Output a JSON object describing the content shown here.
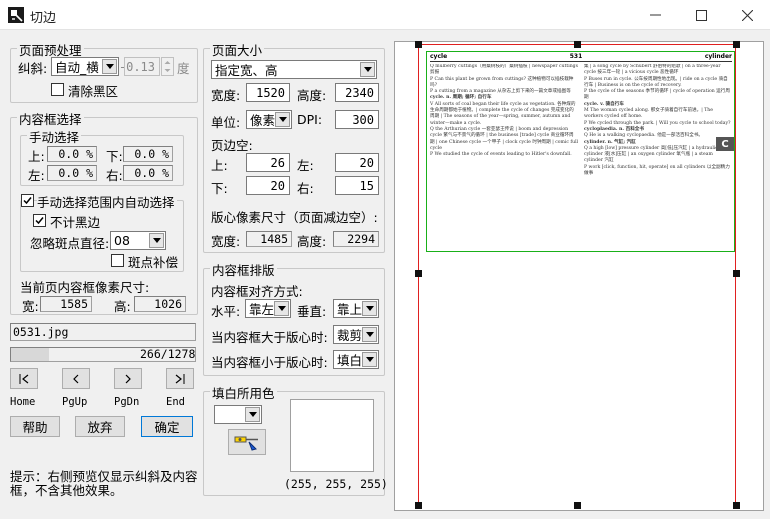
{
  "window": {
    "title": "切边"
  },
  "preprocess": {
    "title": "页面预处理",
    "deskew_label": "纠斜:",
    "deskew_mode": "自动_横",
    "deskew_value": "-0.13",
    "deskew_unit": "度",
    "clear_black_label": "清除黑区"
  },
  "content_select": {
    "title": "内容框选择",
    "manual": {
      "title": "手动选择",
      "top_label": "上:",
      "top_value": "0.0 %",
      "bottom_label": "下:",
      "bottom_value": "0.0 %",
      "left_label": "左:",
      "left_value": "0.0 %",
      "right_label": "右:",
      "right_value": "0.0 %"
    },
    "auto_in_range_label": "手动选择范围内自动选择",
    "exclude_black_label": "不计黑边",
    "ignore_spot_label": "忽略斑点直径:",
    "ignore_spot_value": "08",
    "spot_fill_label": "斑点补偿",
    "current_size_label": "当前页内容框像素尺寸:",
    "width_label": "宽:",
    "width_value": "1585",
    "height_label": "高:",
    "height_value": "1026"
  },
  "file": {
    "name": "0531.jpg",
    "progress_text": "266/1278",
    "progress_fraction": 0.208
  },
  "nav": {
    "home_label": "Home",
    "pgup_label": "PgUp",
    "pgdn_label": "PgDn",
    "end_label": "End"
  },
  "actions": {
    "help": "帮助",
    "discard": "放弃",
    "ok": "确定"
  },
  "hint": "提示：右侧预览仅显示纠斜及内容框，不含其他效果。",
  "page_size": {
    "title": "页面大小",
    "mode": "指定宽、高",
    "width_label": "宽度:",
    "width_value": "1520",
    "height_label": "高度:",
    "height_value": "2340",
    "unit_label": "单位:",
    "unit_value": "像素",
    "dpi_label": "DPI:",
    "dpi_value": "300",
    "margin_label": "页边空:",
    "top_label": "上:",
    "top_value": "26",
    "left_label": "左:",
    "left_value": "20",
    "bottom_label": "下:",
    "bottom_value": "20",
    "right_label": "右:",
    "right_value": "15",
    "layout_size_label": "版心像素尺寸（页面减边空）:",
    "layout_width_label": "宽度:",
    "layout_width_value": "1485",
    "layout_height_label": "高度:",
    "layout_height_value": "2294"
  },
  "content_layout": {
    "title": "内容框排版",
    "align_label": "内容框对齐方式:",
    "horizontal_label": "水平:",
    "horizontal_value": "靠左",
    "vertical_label": "垂直:",
    "vertical_value": "靠上",
    "larger_label": "当内容框大于版心时:",
    "larger_value": "裁剪",
    "smaller_label": "当内容框小于版心时:",
    "smaller_value": "填白"
  },
  "fill_color": {
    "title": "填白所用色",
    "rgb_text": "(255, 255, 255)"
  },
  "preview": {
    "header_left": "cycle",
    "header_center": "531",
    "header_right": "cylinder",
    "side_marker": "C",
    "left_column": [
      "Q  mulberry cuttings（用桑树枝的）桑树插枝 | newspaper cuttings 剪报",
      "P  Can this plant be grown from cuttings? 这种植物可以插枝栽种吗?",
      "P  a cutting from a magazine 从杂志上剪下来的一篇文章或插图等",
      "cycle. n. 周期; 循环; 自行车",
      "V  All sorts of coal began their life cycle as vegetation. 各种煤的生命周期都始于植物。| complete the cycle of changes 完成变化的周期 | The seasons of the year—spring, summer, autumn and winter—make a cycle.",
      "Q  the Arthurian cycle 一套亚瑟王传说 | boom and depression cycle 繁气与不景气的循环 | the business [trade] cycle 商业循环周期 | one Chinese cycle 一个甲子 | clock cycle 时钟周期 | comic full cycle",
      "P  We studied the cycle of events leading to Hitler's downfall."
    ],
    "right_column": [
      "集 | a song cycle by Schubert 舒伯特的组歌 | on a three-year cycle 按三年一轮 | a vicious cycle 恶性循环",
      "P  Buses run in cycle. 公车按周期性地出现。| ride on a cycle 骑自行车 | Business is on the cycle of recovery.",
      "P  the cycle of the seasons 季节的循环 | cycle of operation 运行周期",
      "cycle. v. 骑自行车",
      "M  The woman cycled along. 那女子骑着自行车前进。| The workers cycled off home.",
      "P  We cycled through the park. | Will you cycle to school today?",
      "cycloplaedia. n. 百科全书",
      "Q  He is a walking cyclopaedia. 他是一部活百科全书。",
      "cylinder. n. 气缸; 汽缸",
      "Q  a high [low] pressure cylinder 高[低]压汽缸 | a hydraulic cylinder 液[水]压缸 | an oxygen cylinder 氧气瓶 | a steam cylinder 汽缸",
      "P  work [click, function, hit, operate] on all cylinders 以全副精力做事"
    ]
  }
}
